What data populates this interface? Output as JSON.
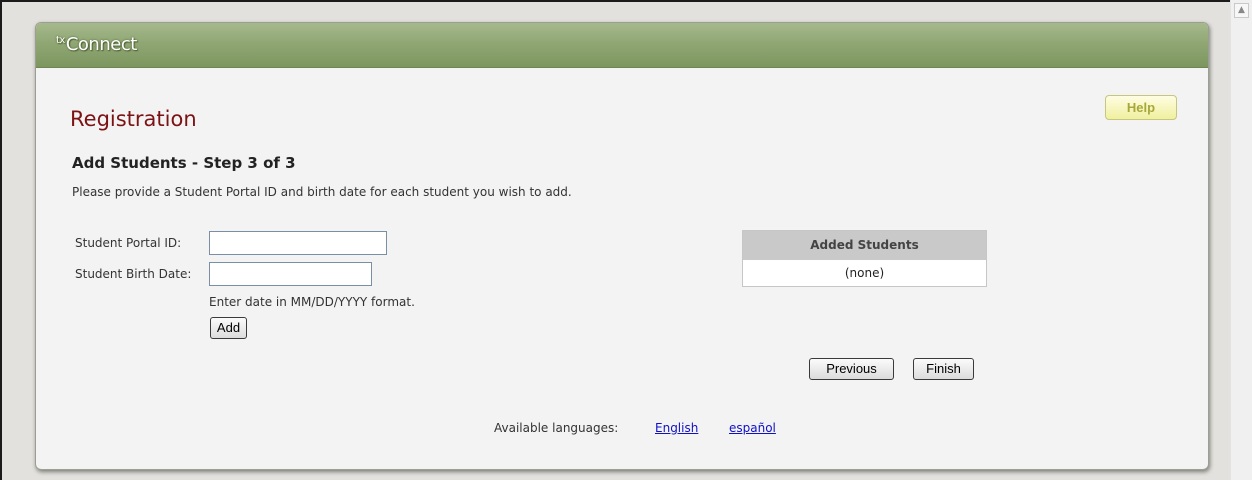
{
  "header": {
    "logo_prefix": "tx",
    "logo_text": "Connect"
  },
  "page": {
    "title": "Registration",
    "help_label": "Help",
    "step_heading": "Add Students - Step 3 of 3",
    "instructions": "Please provide a Student Portal ID and birth date for each student you wish to add."
  },
  "form": {
    "portal_id_label": "Student Portal ID:",
    "portal_id_value": "",
    "birth_date_label": "Student Birth Date:",
    "birth_date_value": "",
    "date_hint": "Enter date in MM/DD/YYYY format.",
    "add_label": "Add"
  },
  "added_students": {
    "header": "Added Students",
    "rows": [
      "(none)"
    ]
  },
  "nav": {
    "previous_label": "Previous",
    "finish_label": "Finish"
  },
  "languages": {
    "label": "Available languages:",
    "options": [
      "English",
      "español"
    ]
  },
  "colors": {
    "header_green": "#90a774",
    "title_red": "#7b1214",
    "link_blue": "#1010c8",
    "help_yellow": "#f0f09f"
  }
}
